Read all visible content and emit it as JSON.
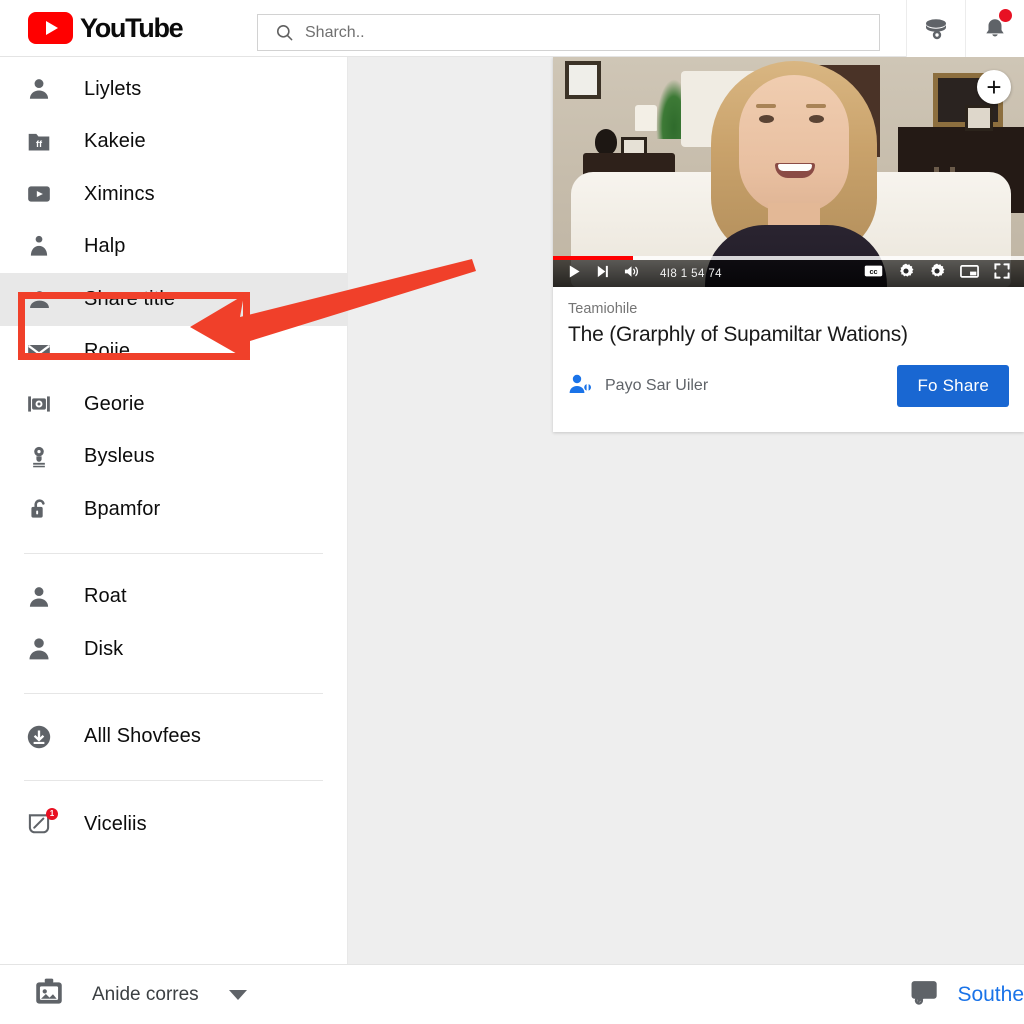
{
  "header": {
    "logo_text": "YouTube",
    "logo_icon": "youtube-play-icon",
    "search": {
      "placeholder": "Sharch..",
      "value": "",
      "icon": "search-icon"
    },
    "buttons": [
      {
        "name": "create-video-button",
        "icon": "video-camera-icon",
        "badge": ""
      },
      {
        "name": "notifications-button",
        "icon": "bell-icon",
        "badge": "1"
      }
    ]
  },
  "sidebar": {
    "group1": [
      {
        "label": "Liylets",
        "icon": "person-icon"
      },
      {
        "label": "Kakeie",
        "icon": "folder-ff-icon"
      },
      {
        "label": "Ximincs",
        "icon": "video-play-icon"
      },
      {
        "label": "Halp",
        "icon": "person-podium-icon"
      },
      {
        "label": "Share title",
        "icon": "person-outline-icon",
        "active": true
      },
      {
        "label": "Roiie",
        "icon": "envelope-icon"
      },
      {
        "label": "Georie",
        "icon": "film-reel-icon"
      },
      {
        "label": "Bysleus",
        "icon": "lightbulb-icon"
      },
      {
        "label": "Bpamfor",
        "icon": "unlock-icon"
      }
    ],
    "group2": [
      {
        "label": "Roat",
        "icon": "person-icon"
      },
      {
        "label": "Disk",
        "icon": "person-filled-icon"
      }
    ],
    "group3": [
      {
        "label": "Alll Shovfees",
        "icon": "circle-download-icon"
      }
    ],
    "group4": [
      {
        "label": "Viceliis",
        "icon": "edit-square-icon",
        "badge": "1"
      }
    ]
  },
  "card": {
    "plus_button": "+",
    "player": {
      "play_icon": "play-icon",
      "next_icon": "next-track-icon",
      "volume_icon": "volume-icon",
      "time": "4I8 1 54 74",
      "cc_icon": "closed-caption-icon",
      "settings_icon": "gear-icon",
      "quality_icon": "gear-icon",
      "theater_icon": "theater-mode-icon",
      "fullscreen_icon": "fullscreen-icon",
      "progress_played_pct": 17,
      "progress_color": "#ff0000"
    },
    "channel": "Teamiohile",
    "title": "The (Grarphly of Supamiltar Wations)",
    "owner": {
      "name": "Payo Sar Uiler",
      "icon": "person-add-icon"
    },
    "share_button": "Fo Share",
    "share_button_color": "#1967d2"
  },
  "footer": {
    "left": {
      "label": "Anide corres",
      "icon": "briefcase-image-icon",
      "caret": "chevron-down-icon"
    },
    "right": {
      "label": "Southe",
      "icon": "comment-bubble-icon",
      "color": "#1a73e8"
    }
  },
  "annotation": {
    "box_color": "#f0402a",
    "arrow_color": "#f0402a",
    "target": "Share title"
  }
}
